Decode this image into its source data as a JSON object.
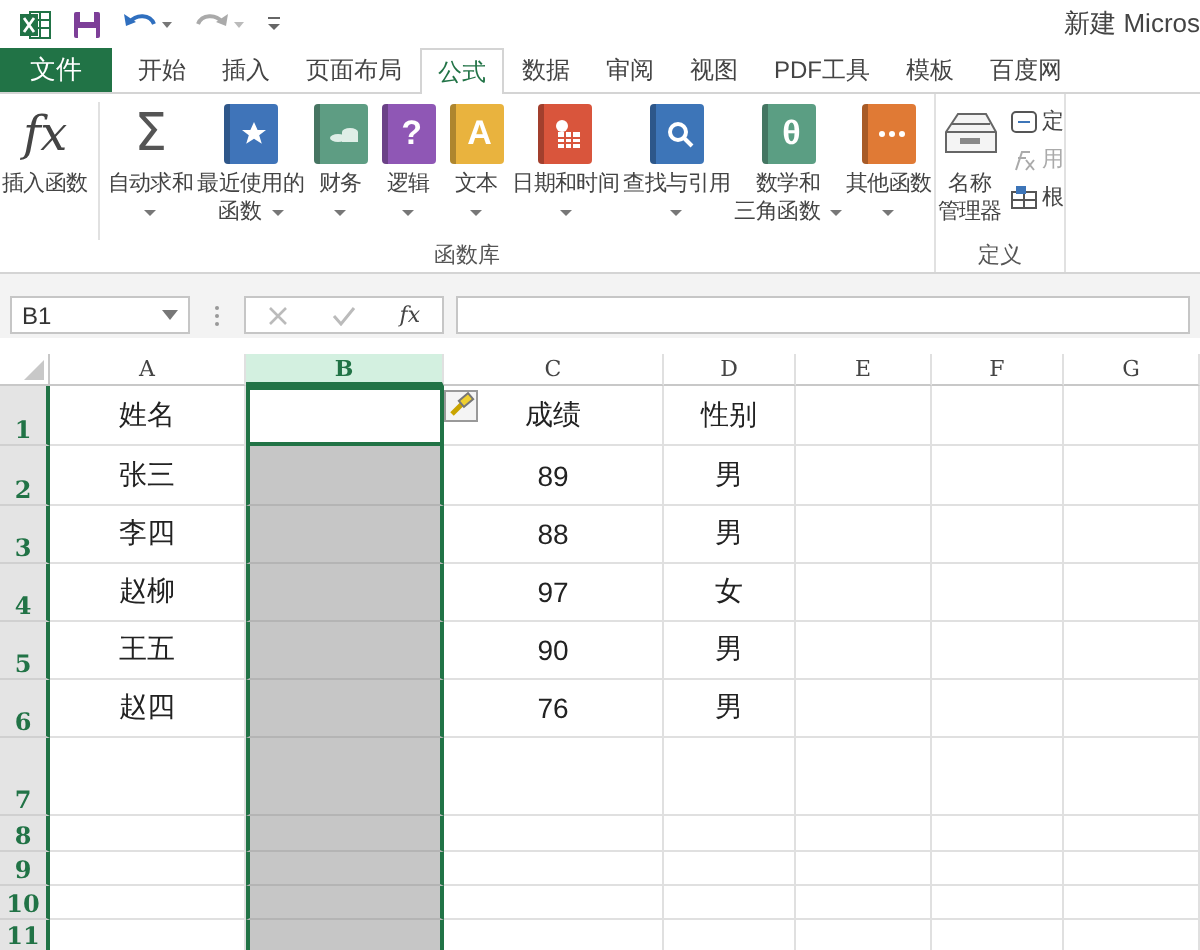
{
  "window": {
    "title": "新建 Micros"
  },
  "file_tab": {
    "label": "文件"
  },
  "tabs": [
    {
      "label": "开始",
      "selected": false
    },
    {
      "label": "插入",
      "selected": false
    },
    {
      "label": "页面布局",
      "selected": false
    },
    {
      "label": "公式",
      "selected": true
    },
    {
      "label": "数据",
      "selected": false
    },
    {
      "label": "审阅",
      "selected": false
    },
    {
      "label": "视图",
      "selected": false
    },
    {
      "label": "PDF工具",
      "selected": false
    },
    {
      "label": "模板",
      "selected": false
    },
    {
      "label": "百度网",
      "selected": false
    }
  ],
  "ribbon": {
    "groups": [
      {
        "label": "函数库",
        "buttons": [
          {
            "glyph": "fx",
            "lines": [
              "插入函数"
            ],
            "dropdown": false,
            "separated": true
          },
          {
            "glyph": "Σ",
            "lines": [
              "自动求和"
            ],
            "dropdown": true,
            "separated": false
          },
          {
            "lines": [
              "最近使用的",
              "函数"
            ],
            "dropdown": true,
            "separated": false
          },
          {
            "lines": [
              "财务"
            ],
            "dropdown": true,
            "separated": false
          },
          {
            "glyph": "?",
            "lines": [
              "逻辑"
            ],
            "dropdown": true,
            "separated": false
          },
          {
            "glyph": "A",
            "lines": [
              "文本"
            ],
            "dropdown": true,
            "separated": false
          },
          {
            "lines": [
              "日期和时间"
            ],
            "dropdown": true,
            "separated": false
          },
          {
            "lines": [
              "查找与引用"
            ],
            "dropdown": true,
            "separated": false
          },
          {
            "glyph": "θ",
            "lines": [
              "数学和",
              "三角函数"
            ],
            "dropdown": true,
            "separated": false
          },
          {
            "lines": [
              "其他函数"
            ],
            "dropdown": true,
            "separated": false
          }
        ]
      },
      {
        "label": "定义",
        "buttons": [
          {
            "lines": [
              "名称",
              "管理器"
            ],
            "dropdown": false,
            "separated": false
          }
        ],
        "small_items": [
          {
            "label": "定",
            "disabled": false
          },
          {
            "label": "用",
            "disabled": true
          },
          {
            "label": "根",
            "disabled": false
          }
        ]
      }
    ]
  },
  "formula_bar": {
    "name_box": "B1",
    "fx": "fx"
  },
  "sheet": {
    "columns": [
      {
        "letter": "A",
        "selected": false
      },
      {
        "letter": "B",
        "selected": true
      },
      {
        "letter": "C",
        "selected": false
      },
      {
        "letter": "D",
        "selected": false
      },
      {
        "letter": "E",
        "selected": false
      },
      {
        "letter": "F",
        "selected": false
      },
      {
        "letter": "G",
        "selected": false
      }
    ],
    "rows": [
      {
        "number": "1",
        "cells": {
          "A": "姓名",
          "C": "成绩",
          "D": "性别"
        }
      },
      {
        "number": "2",
        "cells": {
          "A": "张三",
          "C": "89",
          "D": "男"
        }
      },
      {
        "number": "3",
        "cells": {
          "A": "李四",
          "C": "88",
          "D": "男"
        }
      },
      {
        "number": "4",
        "cells": {
          "A": "赵柳",
          "C": "97",
          "D": "女"
        }
      },
      {
        "number": "5",
        "cells": {
          "A": "王五",
          "C": "90",
          "D": "男"
        }
      },
      {
        "number": "6",
        "cells": {
          "A": "赵四",
          "C": "76",
          "D": "男"
        }
      },
      {
        "number": "7",
        "cells": {}
      },
      {
        "number": "8",
        "cells": {}
      },
      {
        "number": "9",
        "cells": {}
      },
      {
        "number": "10",
        "cells": {}
      },
      {
        "number": "11",
        "cells": {}
      }
    ]
  }
}
